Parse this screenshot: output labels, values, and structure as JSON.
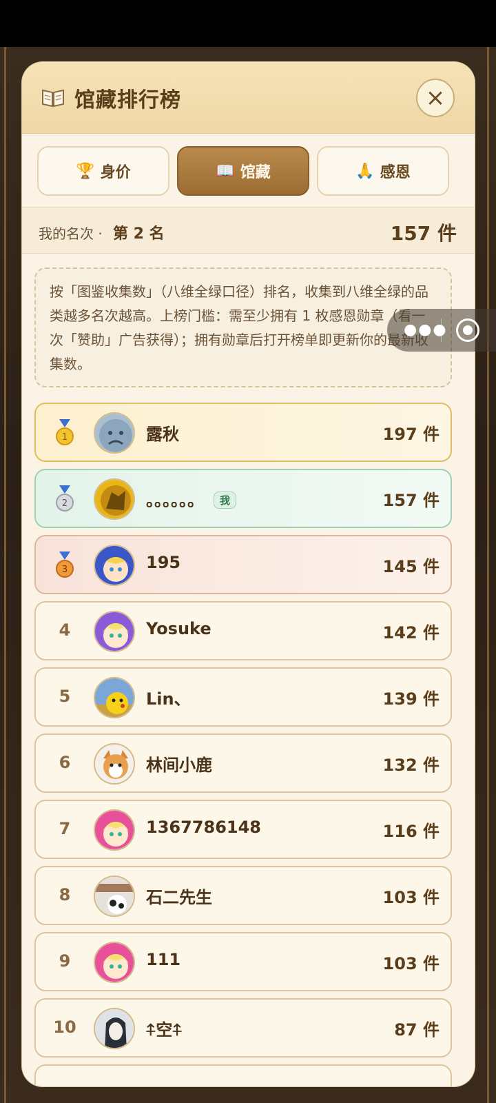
{
  "panel": {
    "title": "馆藏排行榜",
    "close_label": "×"
  },
  "tabs": [
    {
      "label": "身价",
      "icon": "trophy-icon",
      "active": false
    },
    {
      "label": "馆藏",
      "icon": "book-icon",
      "active": true
    },
    {
      "label": "感恩",
      "icon": "pray-icon",
      "active": false
    }
  ],
  "my_rank": {
    "label": "我的名次 · ",
    "value": "第 2 名",
    "count": "157 件"
  },
  "note": "按「图鉴收集数」（八维全绿口径）排名，收集到八维全绿的品类越多名次越高。上榜门槛：需至少拥有 1 枚感恩勋章（看一次「赞助」广告获得）；拥有勋章后打开榜单即更新你的最新收集数。",
  "me_badge": "我",
  "ranking": [
    {
      "rank": "1",
      "name": "露秋",
      "count": "197 件",
      "medal": "gold-medal-icon"
    },
    {
      "rank": "2",
      "name": "。。。。。。",
      "count": "157 件",
      "medal": "silver-medal-icon",
      "is_me": true
    },
    {
      "rank": "3",
      "name": "195",
      "count": "145 件",
      "medal": "bronze-medal-icon"
    },
    {
      "rank": "4",
      "name": "Yosuke",
      "count": "142 件"
    },
    {
      "rank": "5",
      "name": "Lin、",
      "count": "139 件"
    },
    {
      "rank": "6",
      "name": "林间小鹿",
      "count": "132 件"
    },
    {
      "rank": "7",
      "name": "1367786148",
      "count": "116 件"
    },
    {
      "rank": "8",
      "name": "石二先生",
      "count": "103 件"
    },
    {
      "rank": "9",
      "name": "111",
      "count": "103 件"
    },
    {
      "rank": "10",
      "name": "⍏空⍏",
      "count": "87 件"
    }
  ],
  "colors": {
    "accent": "#9c6d33",
    "panel_bg": "#fbf4e6",
    "gold": "#e1bd62",
    "me_green": "#9fd0b2",
    "bronze": "#e0b5a0"
  }
}
